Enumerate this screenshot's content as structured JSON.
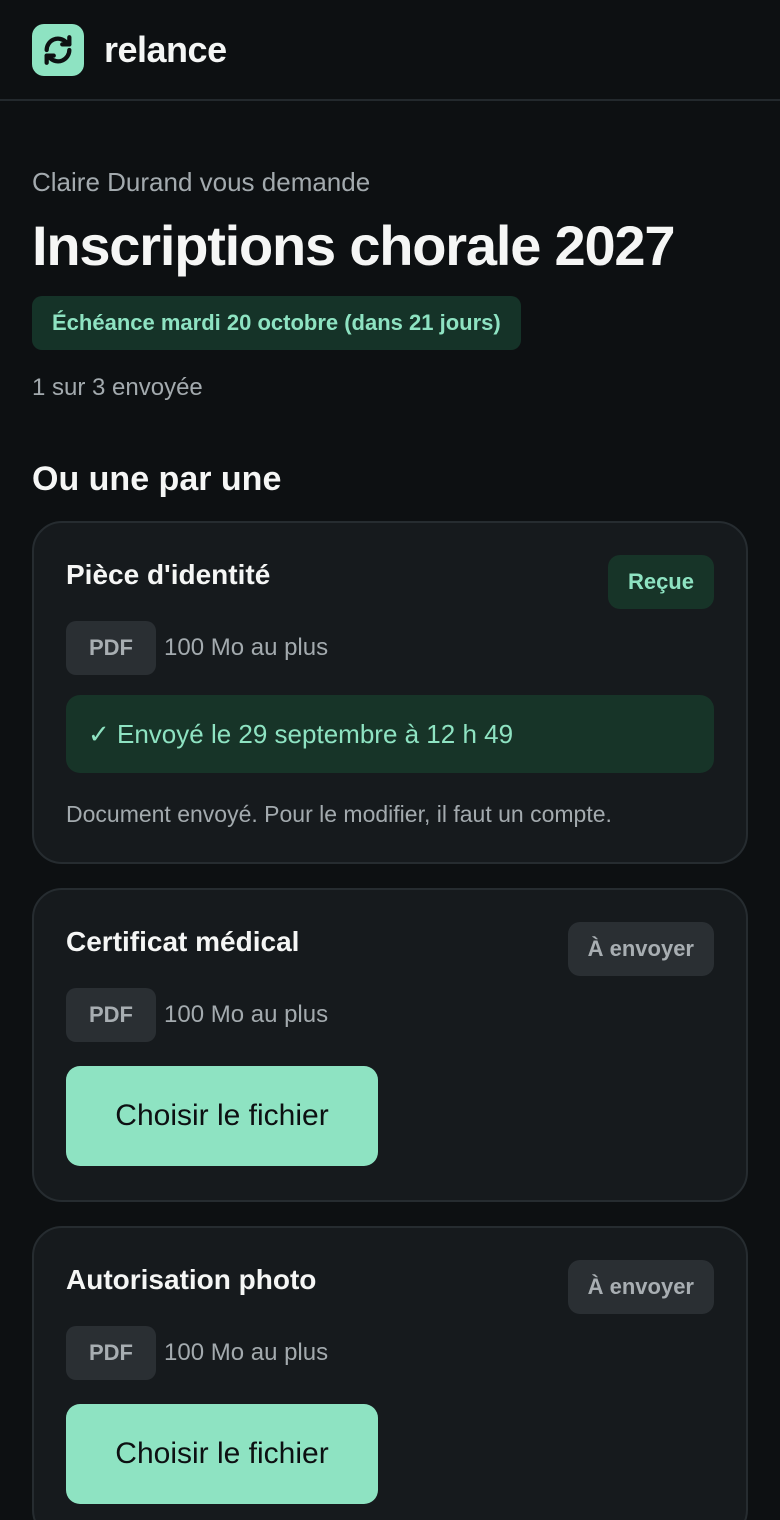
{
  "brand": {
    "name": "relance",
    "icon": "refresh-icon",
    "accent": "#8ee3c2"
  },
  "request": {
    "requester_line": "Claire Durand vous demande",
    "title": "Inscriptions chorale 2027",
    "deadline": "Échéance mardi 20 octobre (dans 21 jours)",
    "progress": "1 sur 3 envoyée"
  },
  "section": {
    "title": "Ou une par une"
  },
  "documents": [
    {
      "title": "Pièce d'identité",
      "status": "Reçue",
      "file_type": "PDF",
      "file_limit": "100 Mo au plus",
      "sent_text": "✓ Envoyé le 29 septembre à 12 h 49",
      "note": "Document envoyé. Pour le modifier, il faut un compte."
    },
    {
      "title": "Certificat médical",
      "status": "À envoyer",
      "file_type": "PDF",
      "file_limit": "100 Mo au plus",
      "button_label": "Choisir le fichier"
    },
    {
      "title": "Autorisation photo",
      "status": "À envoyer",
      "file_type": "PDF",
      "file_limit": "100 Mo au plus",
      "button_label": "Choisir le fichier"
    }
  ]
}
